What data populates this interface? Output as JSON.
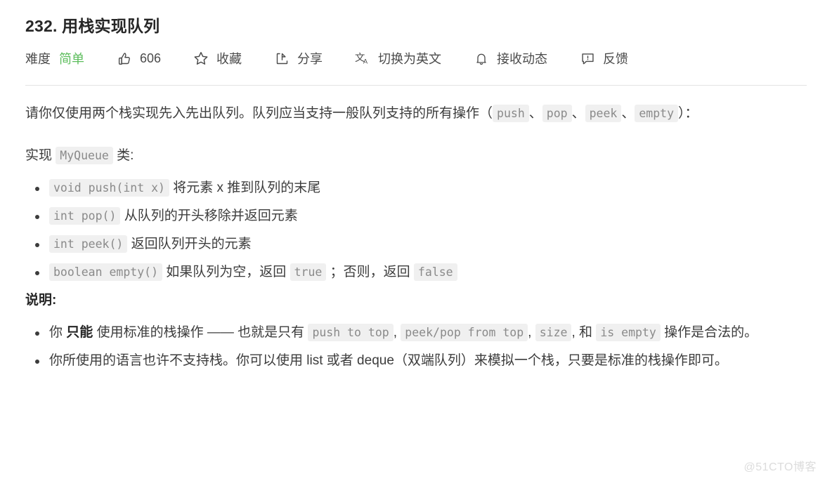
{
  "problem": {
    "title": "232. 用栈实现队列"
  },
  "toolbar": {
    "difficulty_label": "难度",
    "difficulty_value": "简单",
    "difficulty_color": "#5cbd5c",
    "like_count": "606",
    "like_icon": "thumbs-up-icon",
    "favorite_label": "收藏",
    "favorite_icon": "star-icon",
    "share_label": "分享",
    "share_icon": "share-icon",
    "translate_label": "切换为英文",
    "translate_icon": "translate-icon",
    "subscribe_label": "接收动态",
    "subscribe_icon": "bell-icon",
    "feedback_label": "反馈",
    "feedback_icon": "feedback-icon"
  },
  "description": {
    "p1_a": "请你仅使用两个栈实现先入先出队列。队列应当支持一般队列支持的所有操作（",
    "p1_code1": "push",
    "p1_b": "、",
    "p1_code2": "pop",
    "p1_c": "、",
    "p1_code3": "peek",
    "p1_d": "、",
    "p1_code4": "empty",
    "p1_e": "）：",
    "p2_a": "实现",
    "p2_code": "MyQueue",
    "p2_b": "类:"
  },
  "methods": [
    {
      "code": "void push(int x)",
      "text": "将元素 x 推到队列的末尾"
    },
    {
      "code": "int pop()",
      "text": "从队列的开头移除并返回元素"
    },
    {
      "code": "int peek()",
      "text": "返回队列开头的元素"
    }
  ],
  "method_empty": {
    "code": "boolean empty()",
    "text_a": "如果队列为空，返回",
    "code_true": "true",
    "text_b": "；否则，返回",
    "code_false": "false"
  },
  "notes": {
    "heading": "说明:",
    "item1_a": "你",
    "item1_strong": "只能",
    "item1_b": "使用标准的栈操作 —— 也就是只有",
    "item1_code1": "push to top",
    "item1_c": ",",
    "item1_code2": "peek/pop from top",
    "item1_d": ",",
    "item1_code3": "size",
    "item1_e": ", 和",
    "item1_code4": "is empty",
    "item1_f": "操作是合法的。",
    "item2": "你所使用的语言也许不支持栈。你可以使用 list 或者 deque（双端队列）来模拟一个栈，只要是标准的栈操作即可。"
  },
  "watermark": {
    "text": "@51CTO博客"
  }
}
